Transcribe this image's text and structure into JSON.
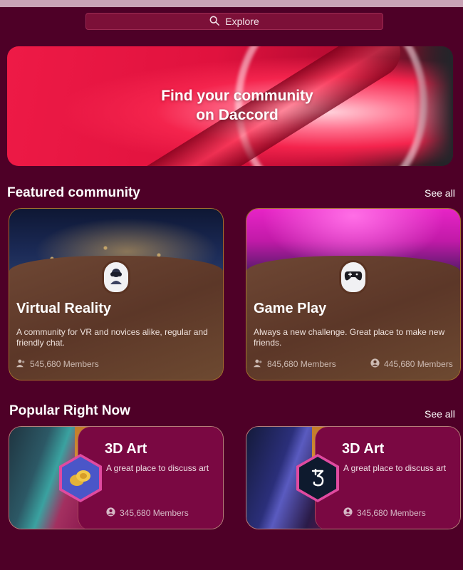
{
  "search": {
    "label": "Explore"
  },
  "hero": {
    "title_line1": "Find your community",
    "title_line2": "on Daccord"
  },
  "featured": {
    "title": "Featured community",
    "see_all": "See all",
    "cards": [
      {
        "name": "Virtual Reality",
        "description": "A community for VR and novices alike, regular and friendly chat.",
        "members": "545,680 Members"
      },
      {
        "name": "Game Play",
        "description": "Always a new challenge. Great place to make new friends.",
        "members": "845,680 Members",
        "members_secondary": "445,680 Members"
      }
    ]
  },
  "popular": {
    "title": "Popular Right Now",
    "see_all": "See all",
    "cards": [
      {
        "title": "3D Art",
        "subtitle": "A great place to discuss art",
        "members": "345,680 Members"
      },
      {
        "title": "3D Art",
        "subtitle": "A great place to discuss art",
        "members": "345,680 Members"
      }
    ]
  },
  "colors": {
    "background": "#4e0027",
    "card_pink": "#7a0842",
    "accent_orange": "#c17c2a"
  },
  "icons": [
    "search-icon",
    "members-icon",
    "user-circle-icon",
    "coin-icon",
    "tezos-icon",
    "vr-headset-icon",
    "gamepad-icon"
  ]
}
